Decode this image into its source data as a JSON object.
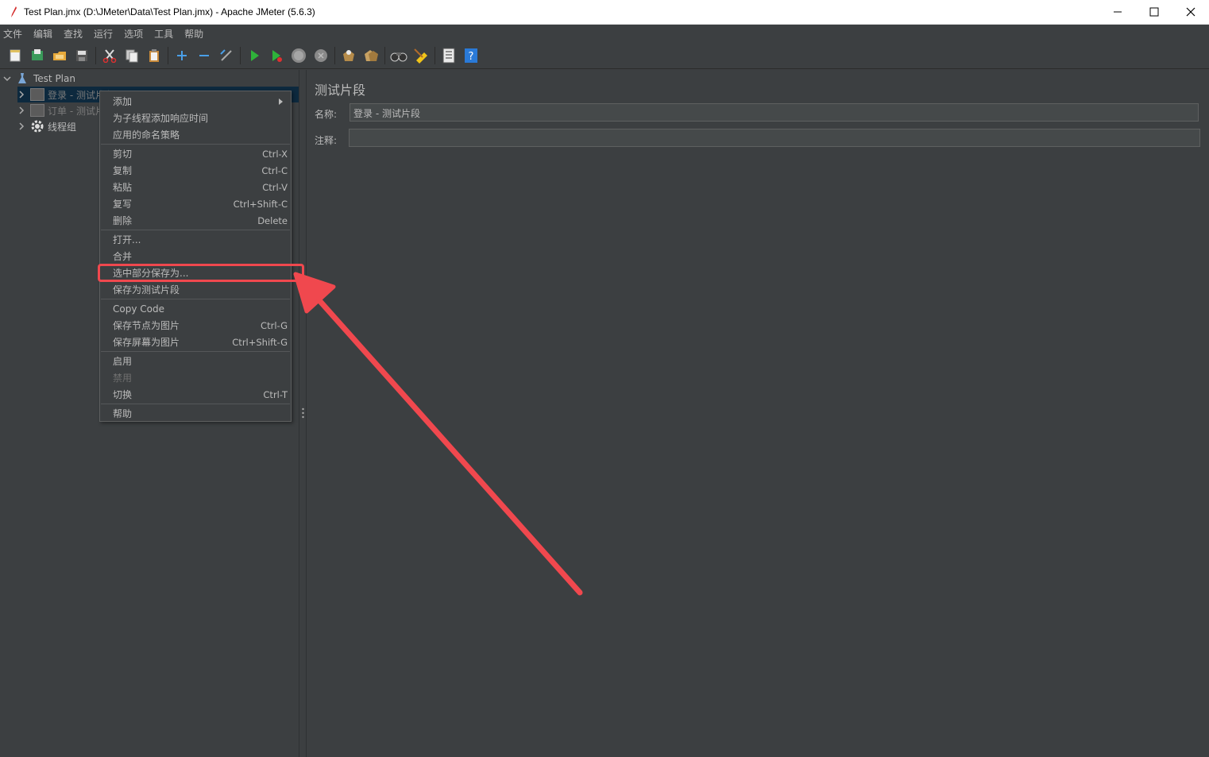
{
  "window": {
    "title": "Test Plan.jmx (D:\\JMeter\\Data\\Test Plan.jmx) - Apache JMeter (5.6.3)"
  },
  "menubar": [
    "文件",
    "编辑",
    "查找",
    "运行",
    "选项",
    "工具",
    "帮助"
  ],
  "toolbar": {
    "icons": [
      "new-icon",
      "templates-icon",
      "open-icon",
      "save-icon",
      "cut-icon",
      "copy-icon",
      "paste-icon",
      "expand-icon",
      "collapse-icon",
      "toggle-icon",
      "start-icon",
      "start-no-pause-icon",
      "stop-icon",
      "shutdown-icon",
      "clear-icon",
      "clear-all-icon",
      "search-icon",
      "reset-search-icon",
      "function-helper-icon",
      "help-icon"
    ]
  },
  "tree": {
    "root": "Test Plan",
    "items": [
      {
        "label": "登录 - 测试片段",
        "selected": true
      },
      {
        "label": "订单 - 测试片段",
        "disabled": true
      },
      {
        "label": "线程组"
      }
    ]
  },
  "panel": {
    "heading": "测试片段",
    "name_label": "名称:",
    "name_value": "登录 - 测试片段",
    "comment_label": "注释:",
    "comment_value": ""
  },
  "context_menu": {
    "groups": [
      [
        {
          "label": "添加",
          "submenu": true
        },
        {
          "label": "为子线程添加响应时间"
        },
        {
          "label": "应用的命名策略"
        }
      ],
      [
        {
          "label": "剪切",
          "shortcut": "Ctrl-X"
        },
        {
          "label": "复制",
          "shortcut": "Ctrl-C"
        },
        {
          "label": "粘贴",
          "shortcut": "Ctrl-V"
        },
        {
          "label": "复写",
          "shortcut": "Ctrl+Shift-C"
        },
        {
          "label": "删除",
          "shortcut": "Delete"
        }
      ],
      [
        {
          "label": "打开..."
        },
        {
          "label": "合并"
        },
        {
          "label": "选中部分保存为...",
          "highlighted": true
        },
        {
          "label": "保存为测试片段"
        }
      ],
      [
        {
          "label": "Copy Code"
        },
        {
          "label": "保存节点为图片",
          "shortcut": "Ctrl-G"
        },
        {
          "label": "保存屏幕为图片",
          "shortcut": "Ctrl+Shift-G"
        }
      ],
      [
        {
          "label": "启用"
        },
        {
          "label": "禁用",
          "disabled": true
        },
        {
          "label": "切换",
          "shortcut": "Ctrl-T"
        }
      ],
      [
        {
          "label": "帮助"
        }
      ]
    ]
  },
  "annotation": {
    "color": "#f0484e"
  }
}
